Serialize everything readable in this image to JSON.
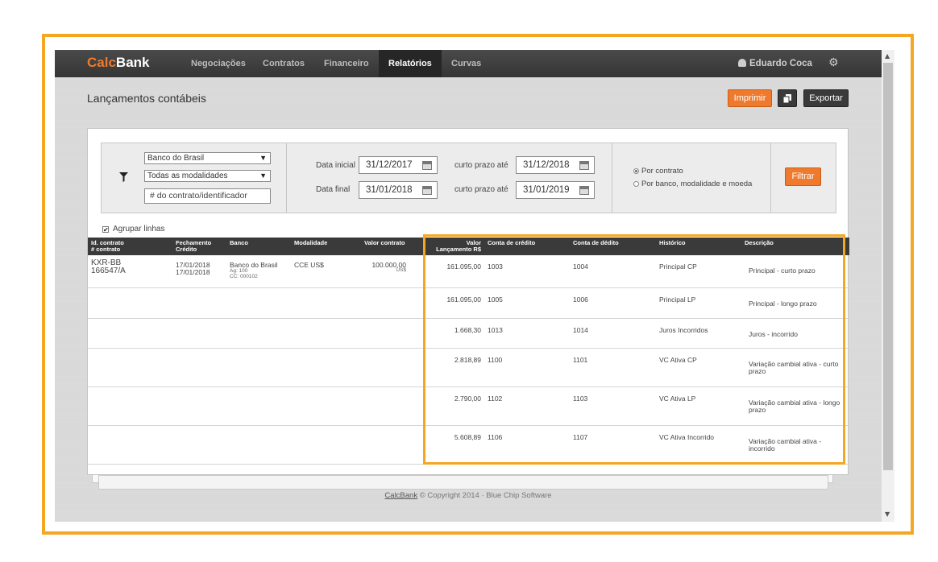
{
  "navbar": {
    "logo_calc": "Calc",
    "logo_bank": "Bank",
    "items": [
      {
        "label": "Negociações"
      },
      {
        "label": "Contratos"
      },
      {
        "label": "Financeiro"
      },
      {
        "label": "Relatórios",
        "active": true
      },
      {
        "label": "Curvas"
      }
    ],
    "user_name": "Eduardo Coca"
  },
  "page": {
    "title": "Lançamentos contábeis",
    "print_label": "Imprimir",
    "export_label": "Exportar"
  },
  "filters": {
    "bank_select": "Banco do Brasil",
    "modality_select": "Todas as modalidades",
    "contract_placeholder": "# do contrato/identificador",
    "start_label": "Data inicial",
    "start_value": "31/12/2017",
    "end_label": "Data final",
    "end_value": "31/01/2018",
    "short_label_1": "curto prazo até",
    "short_value_1": "31/12/2018",
    "short_label_2": "curto prazo até",
    "short_value_2": "31/01/2019",
    "radio_contract": "Por contrato",
    "radio_bank": "Por banco, modalidade e moeda",
    "filter_button": "Filtrar",
    "group_lines": "Agrupar linhas"
  },
  "table": {
    "headers": {
      "id_1": "Id. contrato",
      "id_2": "# contrato",
      "close_1": "Fechamento",
      "close_2": "Crédito",
      "bank": "Banco",
      "modality": "Modalidade",
      "contract_value": "Valor contrato",
      "entry_1": "Valor",
      "entry_2": "Lançamento R$",
      "credit_account": "Conta de crédito",
      "debit_account": "Conta de dédito",
      "history": "Histórico",
      "description": "Descrição"
    },
    "contract": {
      "id_1": "KXR-BB",
      "id_2": "166547/A",
      "close_1": "17/01/2018",
      "close_2": "17/01/2018",
      "bank": "Banco do Brasil",
      "agency": "Ag: 100",
      "account": "CC: 000102",
      "modality": "CCE US$",
      "value": "100.000,00",
      "currency": "US$"
    },
    "rows": [
      {
        "value": "161.095,00",
        "credit": "1003",
        "debit": "1004",
        "history": "Principal CP",
        "description": "Principal - curto prazo"
      },
      {
        "value": "161.095,00",
        "credit": "1005",
        "debit": "1006",
        "history": "Principal LP",
        "description": "Principal - longo prazo"
      },
      {
        "value": "1.668,30",
        "credit": "1013",
        "debit": "1014",
        "history": "Juros Incorridos",
        "description": "Juros - incorrido"
      },
      {
        "value": "2.818,89",
        "credit": "1100",
        "debit": "1101",
        "history": "VC Ativa CP",
        "description": "Variação cambial ativa - curto prazo"
      },
      {
        "value": "2.790,00",
        "credit": "1102",
        "debit": "1103",
        "history": "VC Ativa LP",
        "description": "Variação cambial ativa - longo prazo"
      },
      {
        "value": "5.608,89",
        "credit": "1106",
        "debit": "1107",
        "history": "VC Ativa Incorrido",
        "description": "Variação cambial ativa - incorrido"
      }
    ]
  },
  "footer": {
    "link": "CalcBank",
    "copyright": "© Copyright 2014 · Blue Chip Software"
  },
  "colors": {
    "accent_orange": "#ef7a2e",
    "highlight": "#f5a623",
    "navbar": "#3a3a3a"
  }
}
